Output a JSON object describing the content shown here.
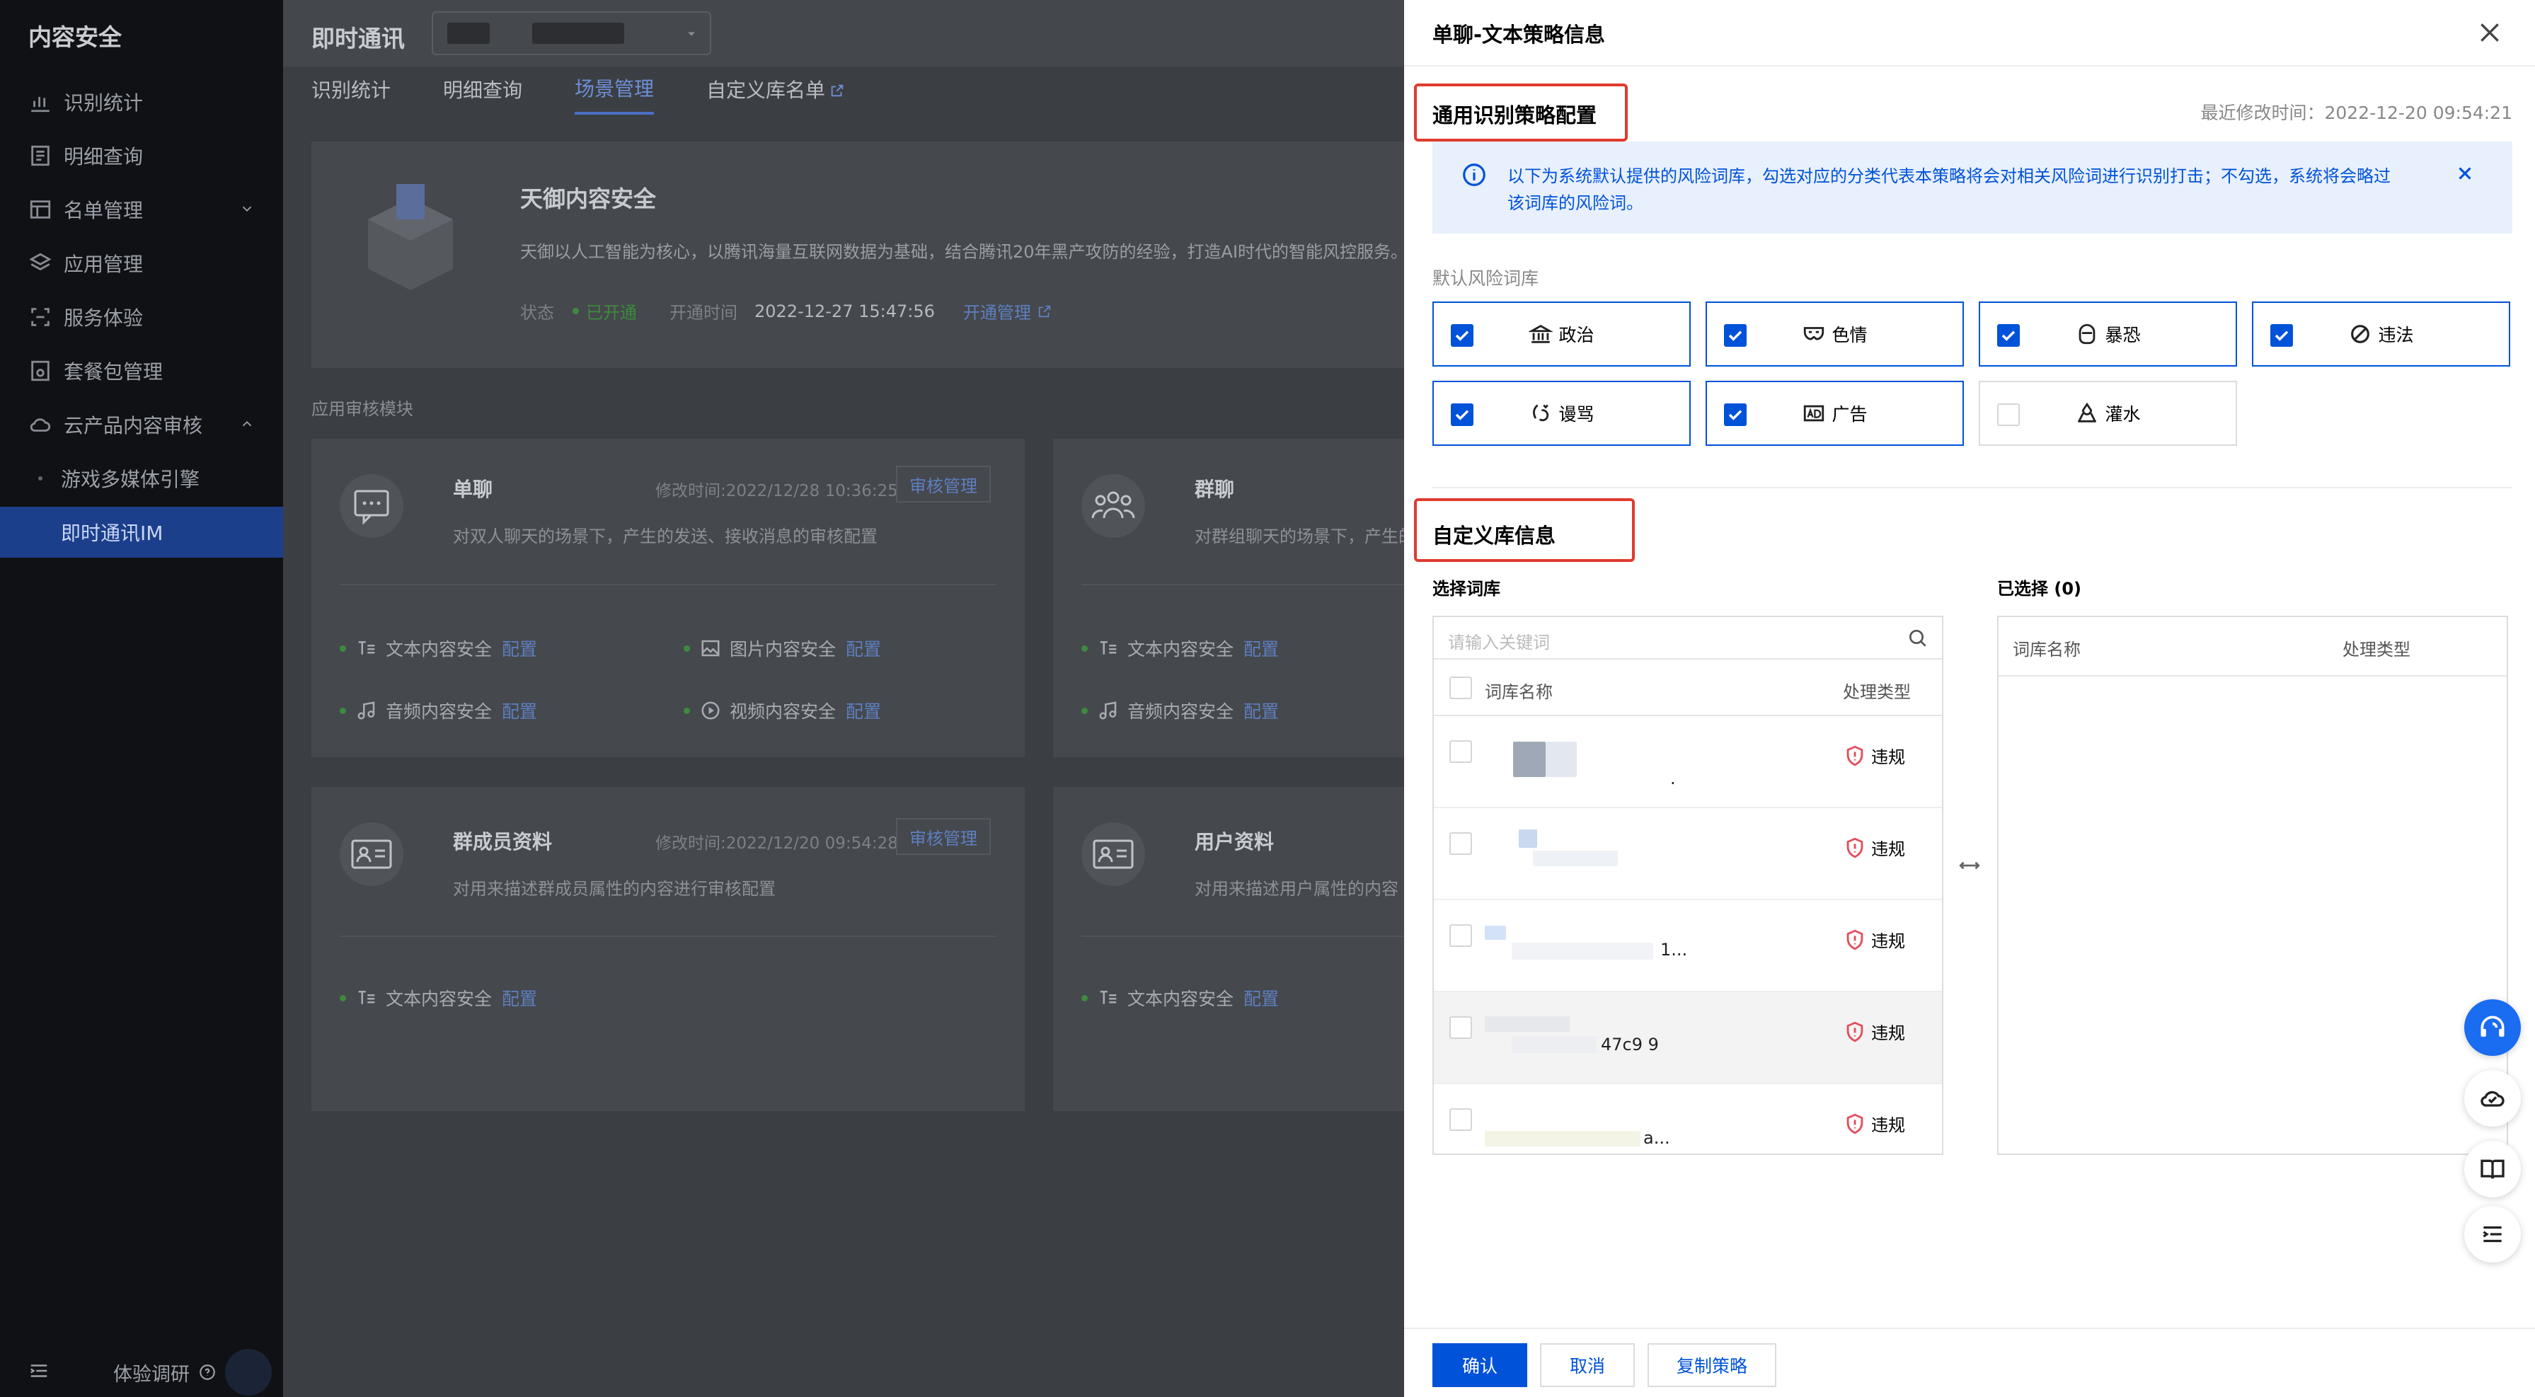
{
  "sidebar": {
    "brand": "内容安全",
    "items": [
      {
        "label": "识别统计",
        "icon": "bar-chart-icon"
      },
      {
        "label": "明细查询",
        "icon": "document-icon"
      },
      {
        "label": "名单管理",
        "icon": "list-icon"
      },
      {
        "label": "应用管理",
        "icon": "layers-icon"
      },
      {
        "label": "服务体验",
        "icon": "scan-icon"
      },
      {
        "label": "套餐包管理",
        "icon": "package-icon"
      },
      {
        "label": "云产品内容审核",
        "icon": "cloud-icon"
      },
      {
        "label": "游戏多媒体引擎",
        "icon": ""
      },
      {
        "label": "即时通讯IM",
        "icon": ""
      }
    ],
    "footer": "体验调研"
  },
  "main": {
    "title": "即时通讯",
    "tabs": [
      "识别统计",
      "明细查询",
      "场景管理",
      "自定义库名单"
    ],
    "active_tab": "场景管理",
    "product": {
      "name": "天御内容安全",
      "desc": "天御以人工智能为核心，以腾讯海量互联网数据为基础，结合腾讯20年黑产攻防的经验，打造AI时代的智能风控服务。",
      "status_label": "状态",
      "status": "已开通",
      "open_time_label": "开通时间",
      "open_time": "2022-12-27 15:47:56",
      "manage_link": "开通管理"
    },
    "section_label": "应用审核模块",
    "modules": [
      {
        "title": "单聊",
        "time": "修改时间:2022/12/28 10:36:25",
        "button": "审核管理",
        "desc": "对双人聊天的场景下，产生的发送、接收消息的审核配置",
        "features": [
          "文本内容安全",
          "图片内容安全",
          "音频内容安全",
          "视频内容安全"
        ]
      },
      {
        "title": "群聊",
        "time": "",
        "button": "",
        "desc": "对群组聊天的场景下，产生的",
        "features": [
          "文本内容安全",
          "音频内容安全"
        ]
      },
      {
        "title": "群成员资料",
        "time": "修改时间:2022/12/20 09:54:28",
        "button": "审核管理",
        "desc": "对用来描述群成员属性的内容进行审核配置",
        "features": [
          "文本内容安全"
        ]
      },
      {
        "title": "用户资料",
        "time": "",
        "button": "",
        "desc": "对用来描述用户属性的内容",
        "features": [
          "文本内容安全"
        ]
      }
    ],
    "config_link": "配置"
  },
  "drawer": {
    "title": "单聊-文本策略信息",
    "section1": "通用识别策略配置",
    "updated": "最近修改时间：2022-12-20 09:54:21",
    "alert": "以下为系统默认提供的风险词库，勾选对应的分类代表本策略将会对相关风险词进行识别打击；不勾选，系统将会略过该词库的风险词。",
    "default_label": "默认风险词库",
    "categories": [
      {
        "label": "政治",
        "checked": true,
        "icon": "government-icon"
      },
      {
        "label": "色情",
        "checked": true,
        "icon": "mask-icon"
      },
      {
        "label": "暴恐",
        "checked": true,
        "icon": "balaclava-icon"
      },
      {
        "label": "违法",
        "checked": true,
        "icon": "forbidden-icon"
      },
      {
        "label": "谩骂",
        "checked": true,
        "icon": "angry-icon"
      },
      {
        "label": "广告",
        "checked": true,
        "icon": "ad-icon"
      },
      {
        "label": "灌水",
        "checked": false,
        "icon": "water-icon"
      }
    ],
    "section2": "自定义库信息",
    "select_label": "选择词库",
    "selected_label": "已选择 (0)",
    "search_placeholder": "请输入关键词",
    "col_name": "词库名称",
    "col_type": "处理类型",
    "rows": [
      {
        "type": "违规",
        "suffix": "."
      },
      {
        "type": "违规",
        "suffix": ""
      },
      {
        "type": "违规",
        "suffix": "1..."
      },
      {
        "type": "违规",
        "suffix": "47c9 9"
      },
      {
        "type": "违规",
        "suffix": "a..."
      }
    ],
    "confirm": "确认",
    "cancel": "取消",
    "copy": "复制策略"
  }
}
